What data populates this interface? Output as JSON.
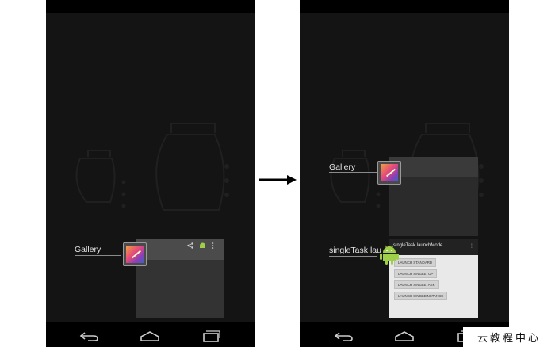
{
  "left_screen": {
    "recent_apps": [
      {
        "label": "Gallery"
      }
    ],
    "action_bar_icons": [
      "share-icon",
      "android-icon",
      "overflow-menu-icon"
    ]
  },
  "right_screen": {
    "recent_apps": [
      {
        "label": "Gallery"
      },
      {
        "label": "singleTask lau"
      }
    ],
    "task_thumbnail": {
      "title": "singleTask launchMode",
      "menu": "⋮",
      "buttons": [
        "LAUNCH STANDARD",
        "LAUNCH SINGLETOP",
        "LAUNCH SINGLETASK",
        "LAUNCH SINGLEINSTANCE"
      ]
    }
  },
  "navigation_icons": [
    "back-icon",
    "home-icon",
    "recent-apps-icon"
  ],
  "transition_arrow_icon": "right-arrow-icon",
  "watermark": "云教程中心",
  "colors": {
    "screen_background": "#141414",
    "bars": "#000000",
    "thumbnail": "#3b3b3b",
    "task_thumbnail": "#e9e9e9",
    "android_green": "#9fcf4a"
  }
}
